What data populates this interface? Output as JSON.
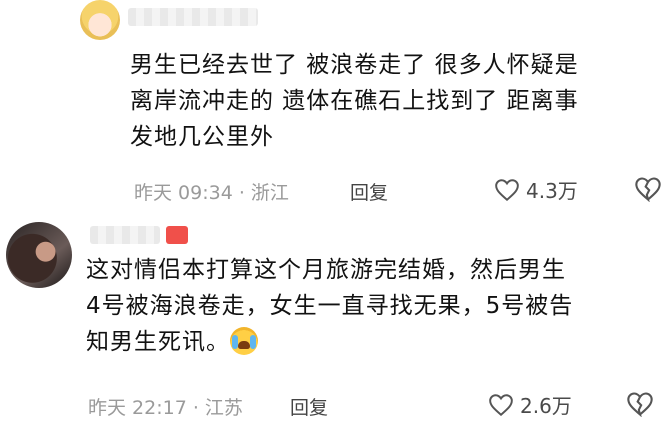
{
  "comments": [
    {
      "text": "男生已经去世了 被浪卷走了 很多人怀疑是\n离岸流冲走的 遗体在礁石上找到了 距离事\n发地几公里外",
      "meta": "昨天 09:34 · 浙江",
      "reply_label": "回复",
      "likes": "4.3万"
    },
    {
      "text": "这对情侣本打算这个月旅游完结婚，然后男生\n4号被海浪卷走，女生一直寻找无果，5号被告\n知男生死讯。",
      "emoji": "crying-face",
      "meta": "昨天 22:17 · 江苏",
      "reply_label": "回复",
      "likes": "2.6万"
    }
  ],
  "colors": {
    "text": "#121212",
    "meta": "#9a9a9a",
    "flag": "#f0504a"
  }
}
